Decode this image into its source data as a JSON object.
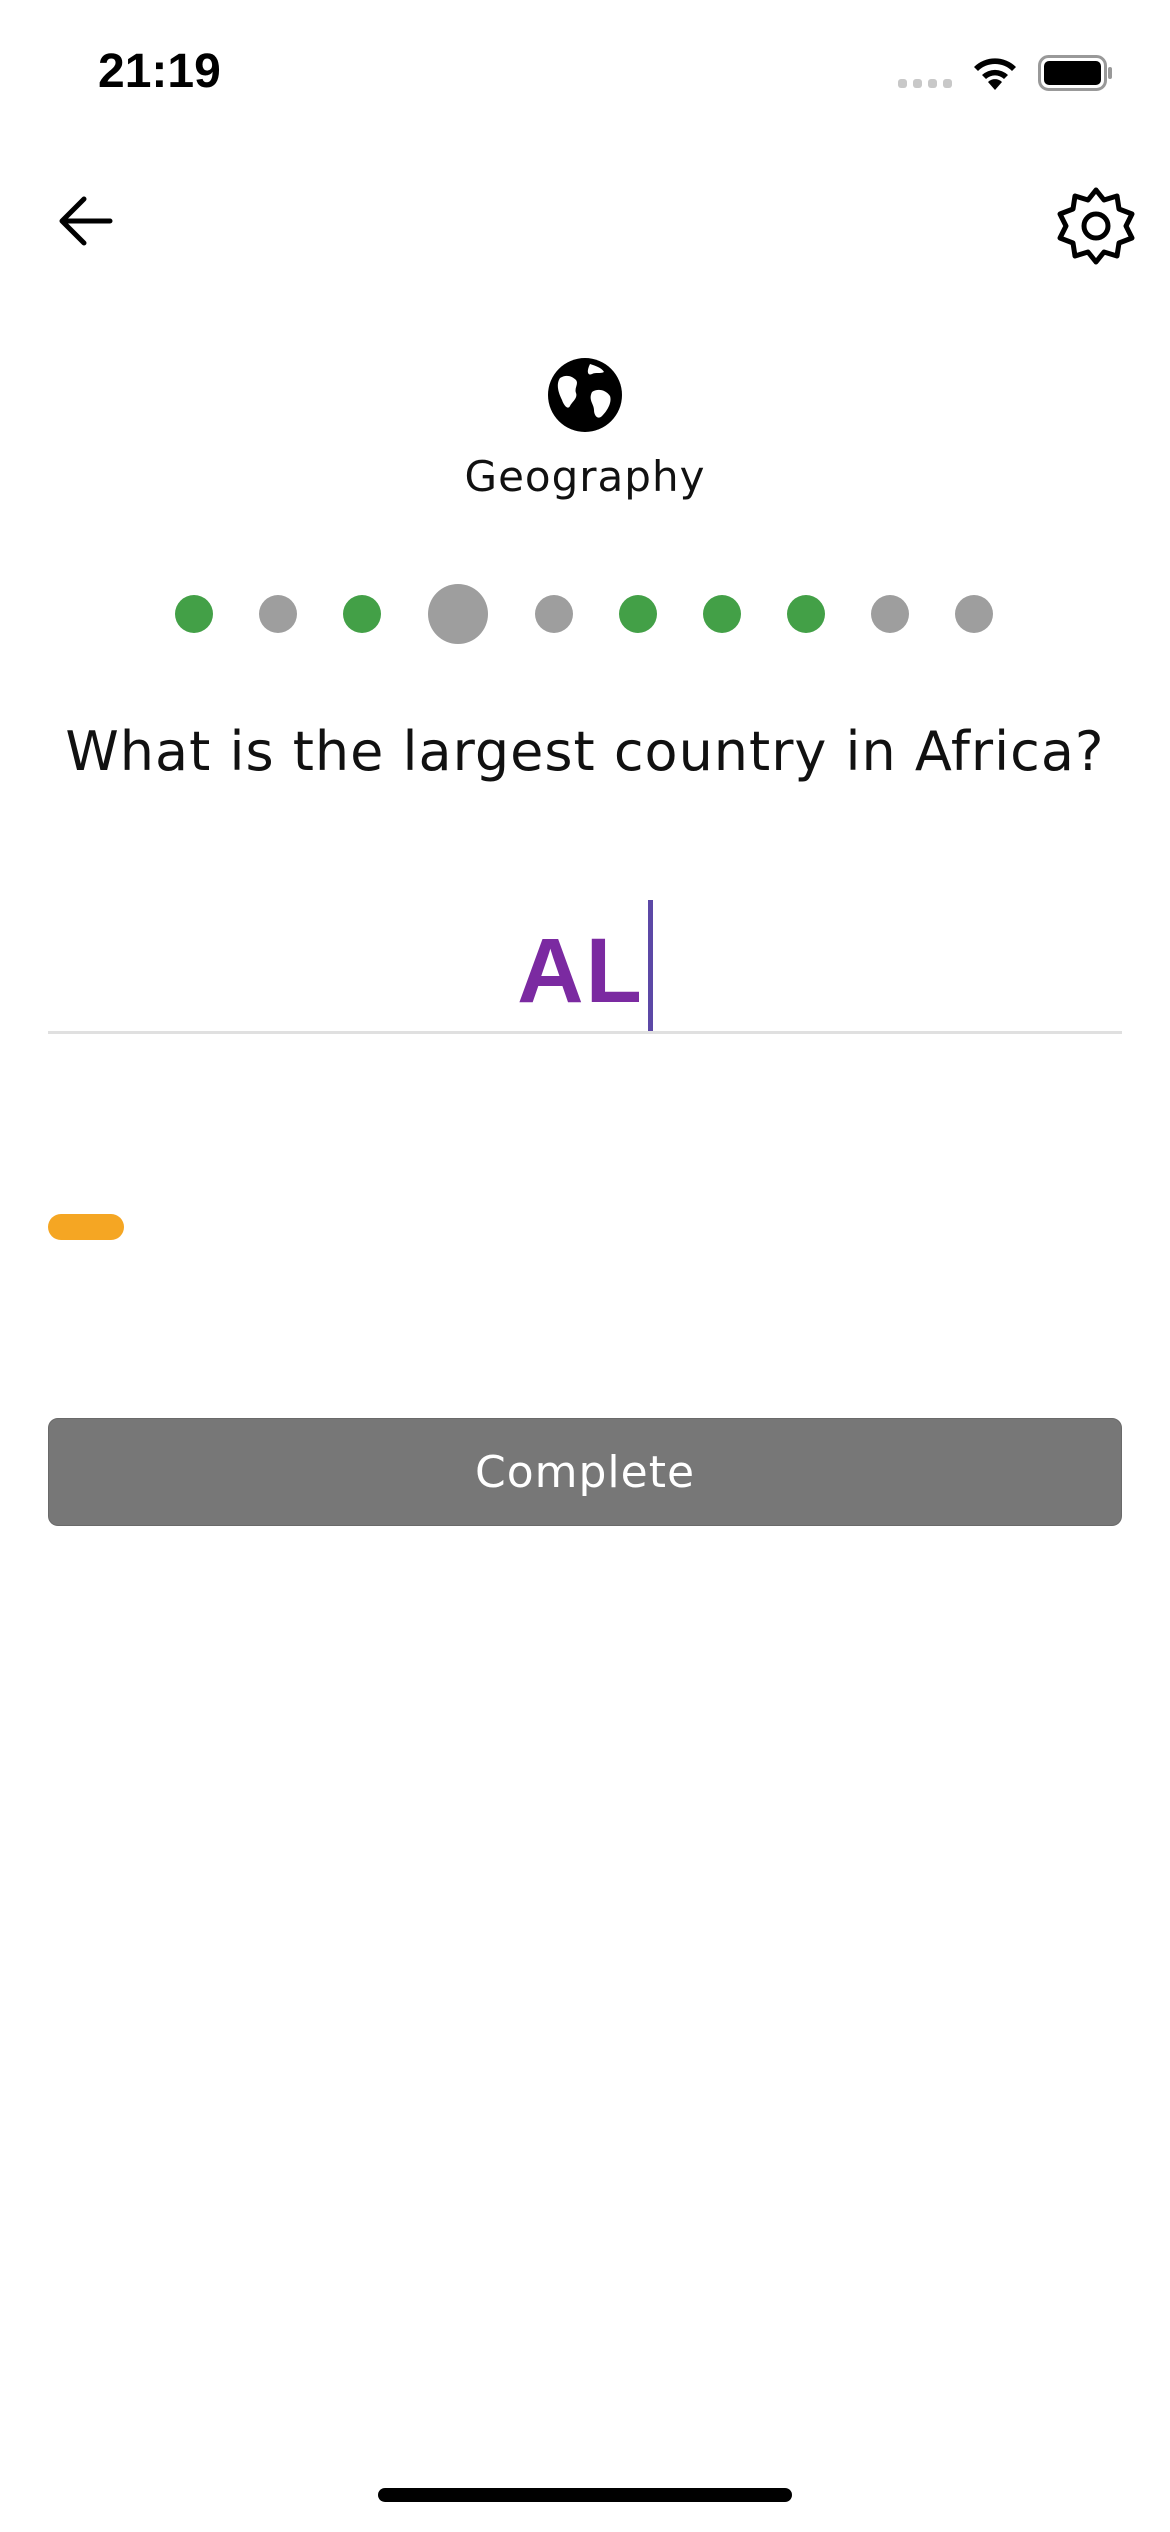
{
  "status_bar": {
    "time": "21:19"
  },
  "nav": {
    "back_icon": "arrow-left-icon",
    "settings_icon": "gear-icon"
  },
  "category": {
    "icon": "globe-icon",
    "label": "Geography"
  },
  "progress": {
    "states": [
      "correct",
      "unanswered",
      "correct",
      "current",
      "unanswered",
      "correct",
      "correct",
      "correct",
      "unanswered",
      "unanswered"
    ],
    "colors": {
      "correct": "#43a047",
      "unanswered": "#9e9e9e",
      "current": "#9e9e9e"
    }
  },
  "question": {
    "text": "What is the largest country in Africa?"
  },
  "answer": {
    "value": "AL",
    "color": "#7b2aa1"
  },
  "timer": {
    "color": "#f5a623"
  },
  "actions": {
    "complete_label": "Complete",
    "complete_color": "#777777"
  }
}
